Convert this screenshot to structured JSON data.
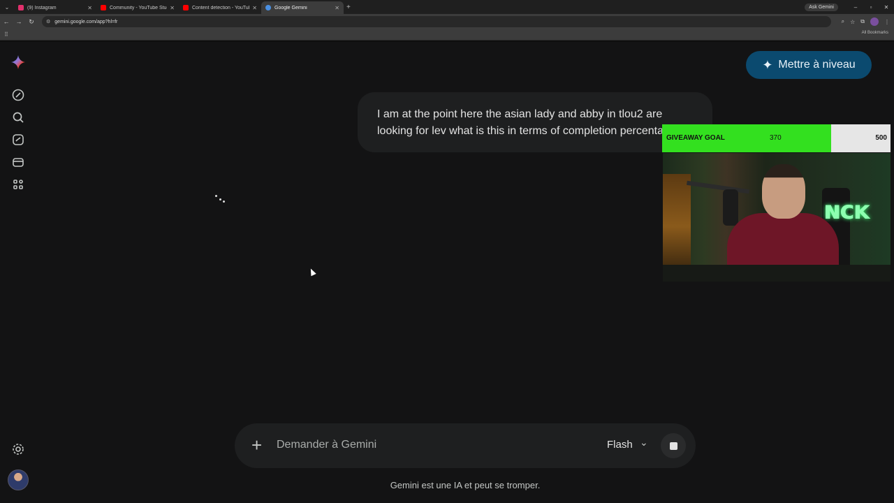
{
  "browser": {
    "tabs": [
      {
        "title": "(9) Instagram",
        "favicon_color": "#e1306c",
        "active": false
      },
      {
        "title": "Community - YouTube Studio",
        "favicon_color": "#ff0000",
        "active": false
      },
      {
        "title": "Content detection - YouTube St",
        "favicon_color": "#ff0000",
        "active": false
      },
      {
        "title": "Google Gemini",
        "favicon_color": "#4a90e2",
        "active": true
      }
    ],
    "new_tab": "+",
    "ask_gemini": "Ask Gemini",
    "url": "gemini.google.com/app?hl=fr",
    "all_bookmarks": "All Bookmarks"
  },
  "gemini": {
    "upgrade_label": "Mettre à niveau",
    "user_message": "I am at the point here the asian lady and abby in tlou2 are looking for lev what is this in terms of completion percentage",
    "composer": {
      "placeholder": "Demander à Gemini",
      "model": "Flash"
    },
    "disclaimer": "Gemini est une IA et peut se tromper."
  },
  "overlay": {
    "goal_label": "GIVEAWAY GOAL",
    "goal_current": 370,
    "goal_target": 500,
    "goal_progress": 0.74,
    "goal_fill_color": "#33e01f"
  }
}
